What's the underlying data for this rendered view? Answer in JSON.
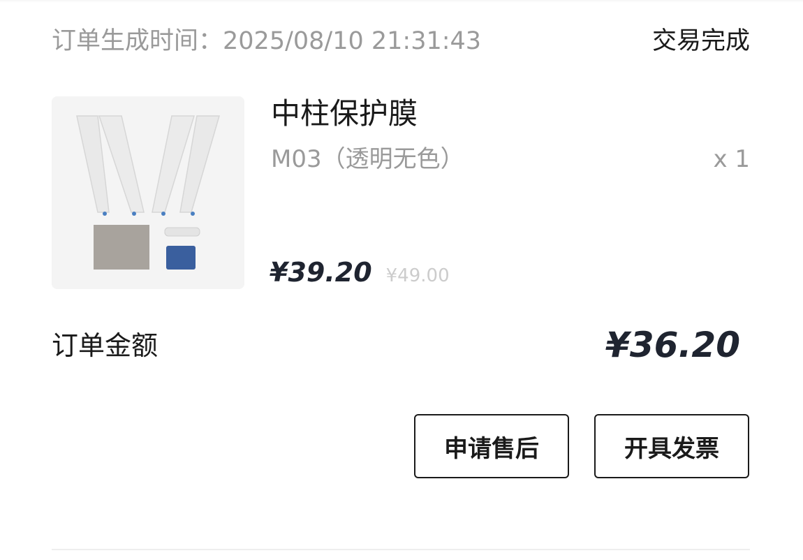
{
  "order": {
    "time_label": "订单生成时间：",
    "time_value": "2025/08/10 21:31:43",
    "status": "交易完成"
  },
  "product": {
    "name": "中柱保护膜",
    "spec": "M03（透明无色）",
    "quantity": "x 1",
    "price": "¥39.20",
    "original_price": "¥49.00"
  },
  "summary": {
    "total_label": "订单金额",
    "total_value": "¥36.20"
  },
  "actions": {
    "after_sale": "申请售后",
    "invoice": "开具发票"
  }
}
